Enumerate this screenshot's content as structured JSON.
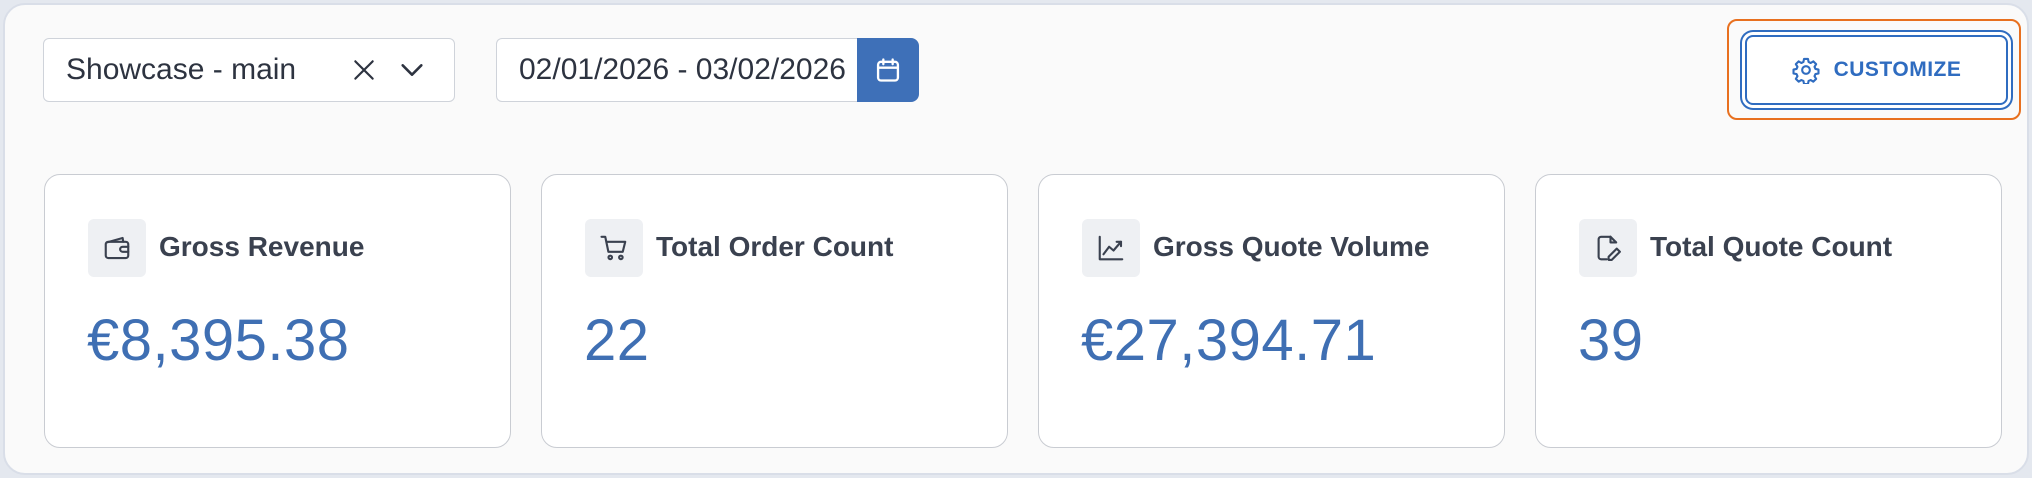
{
  "toolbar": {
    "scope_select": {
      "value": "Showcase - main"
    },
    "date_range": {
      "value": "02/01/2026 - 03/02/2026"
    },
    "customize_label": "CUSTOMIZE"
  },
  "cards": [
    {
      "title": "Gross Revenue",
      "value": "€8,395.38",
      "icon": "wallet-icon"
    },
    {
      "title": "Total Order Count",
      "value": "22",
      "icon": "cart-icon"
    },
    {
      "title": "Gross Quote Volume",
      "value": "€27,394.71",
      "icon": "trend-chart-icon"
    },
    {
      "title": "Total Quote Count",
      "value": "39",
      "icon": "quote-edit-icon"
    }
  ],
  "colors": {
    "accent": "#3e70b8",
    "value_text": "#3f6fb3",
    "focus_ring": "#e8701f"
  }
}
